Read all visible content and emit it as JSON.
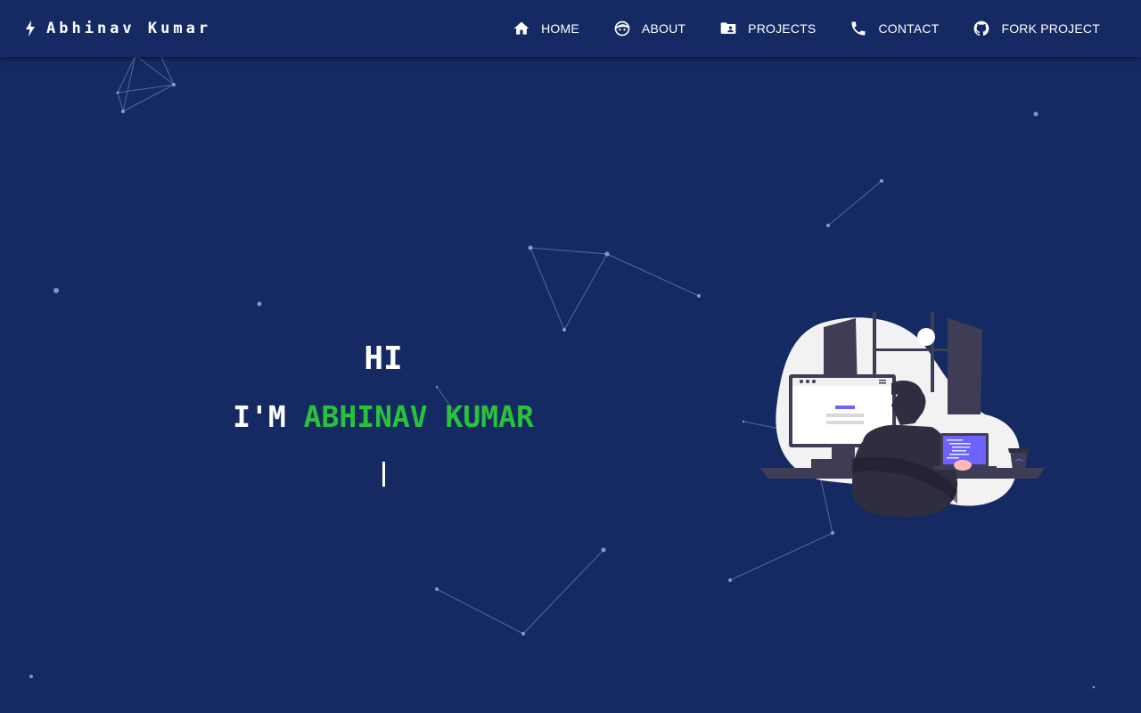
{
  "brand": {
    "name": "Abhinav Kumar",
    "icon": "bolt-icon"
  },
  "nav": {
    "items": [
      {
        "label": "HOME",
        "icon": "home-icon"
      },
      {
        "label": "ABOUT",
        "icon": "face-icon"
      },
      {
        "label": "PROJECTS",
        "icon": "folder-account-icon"
      },
      {
        "label": "CONTACT",
        "icon": "phone-icon"
      },
      {
        "label": "FORK PROJECT",
        "icon": "github-icon"
      }
    ]
  },
  "hero": {
    "greeting": "HI",
    "intro_prefix": "I'M",
    "name": "ABHINAV KUMAR"
  },
  "colors": {
    "background": "#152a63",
    "accent": "#2bc13c",
    "text": "#ffffff"
  }
}
